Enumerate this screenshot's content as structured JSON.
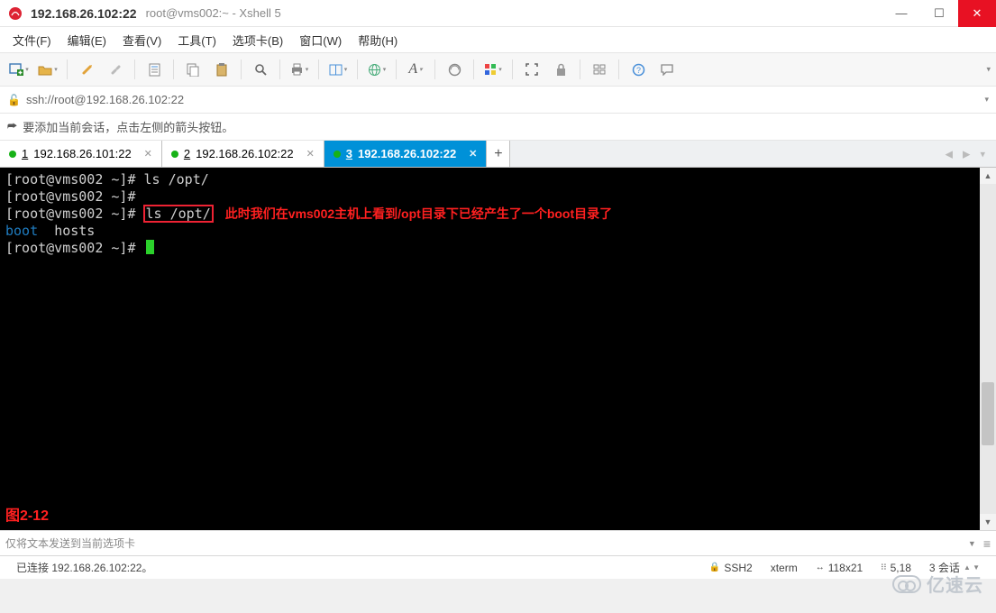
{
  "window": {
    "title_main": "192.168.26.102:22",
    "title_sub": "root@vms002:~ - Xshell 5"
  },
  "menu": {
    "file": "文件(F)",
    "edit": "编辑(E)",
    "view": "查看(V)",
    "tools": "工具(T)",
    "tabs": "选项卡(B)",
    "window": "窗口(W)",
    "help": "帮助(H)"
  },
  "toolbar_icons": {
    "new": "new-session",
    "open": "open",
    "reconnect": "reconnect",
    "disconnect": "disconnect",
    "copy": "copy",
    "paste": "paste",
    "find": "find",
    "print": "print",
    "layout": "layout",
    "globe": "globe",
    "font": "font",
    "encoding": "encoding",
    "color": "color",
    "fullscreen": "fullscreen",
    "lock": "lock",
    "tile": "tile",
    "help": "help",
    "chat": "chat"
  },
  "address": {
    "url": "ssh://root@192.168.26.102:22"
  },
  "tip": "要添加当前会话，点击左侧的箭头按钮。",
  "tabs": [
    {
      "num": "1",
      "label": "192.168.26.101:22",
      "active": false
    },
    {
      "num": "2",
      "label": "192.168.26.102:22",
      "active": false
    },
    {
      "num": "3",
      "label": "192.168.26.102:22",
      "active": true
    }
  ],
  "new_tab": "+",
  "terminal": {
    "line1_prompt": "[root@vms002 ~]# ",
    "line1_cmd": "ls /opt/",
    "line2_prompt": "[root@vms002 ~]#",
    "line3_prompt": "[root@vms002 ~]# ",
    "line3_cmd": "ls /opt/",
    "annotation": "此时我们在vms002主机上看到/opt目录下已经产生了一个boot目录了",
    "out_boot": "boot",
    "out_hosts": "hosts",
    "line5_prompt": "[root@vms002 ~]# ",
    "figure_label": "图2-12"
  },
  "send_bar": {
    "text": "仅将文本发送到当前选项卡"
  },
  "status": {
    "connected": "已连接 192.168.26.102:22。",
    "protocol": "SSH2",
    "termtype": "xterm",
    "size": "118x21",
    "cursor": "5,18",
    "sessions": "3 会话"
  },
  "watermark": "亿速云"
}
